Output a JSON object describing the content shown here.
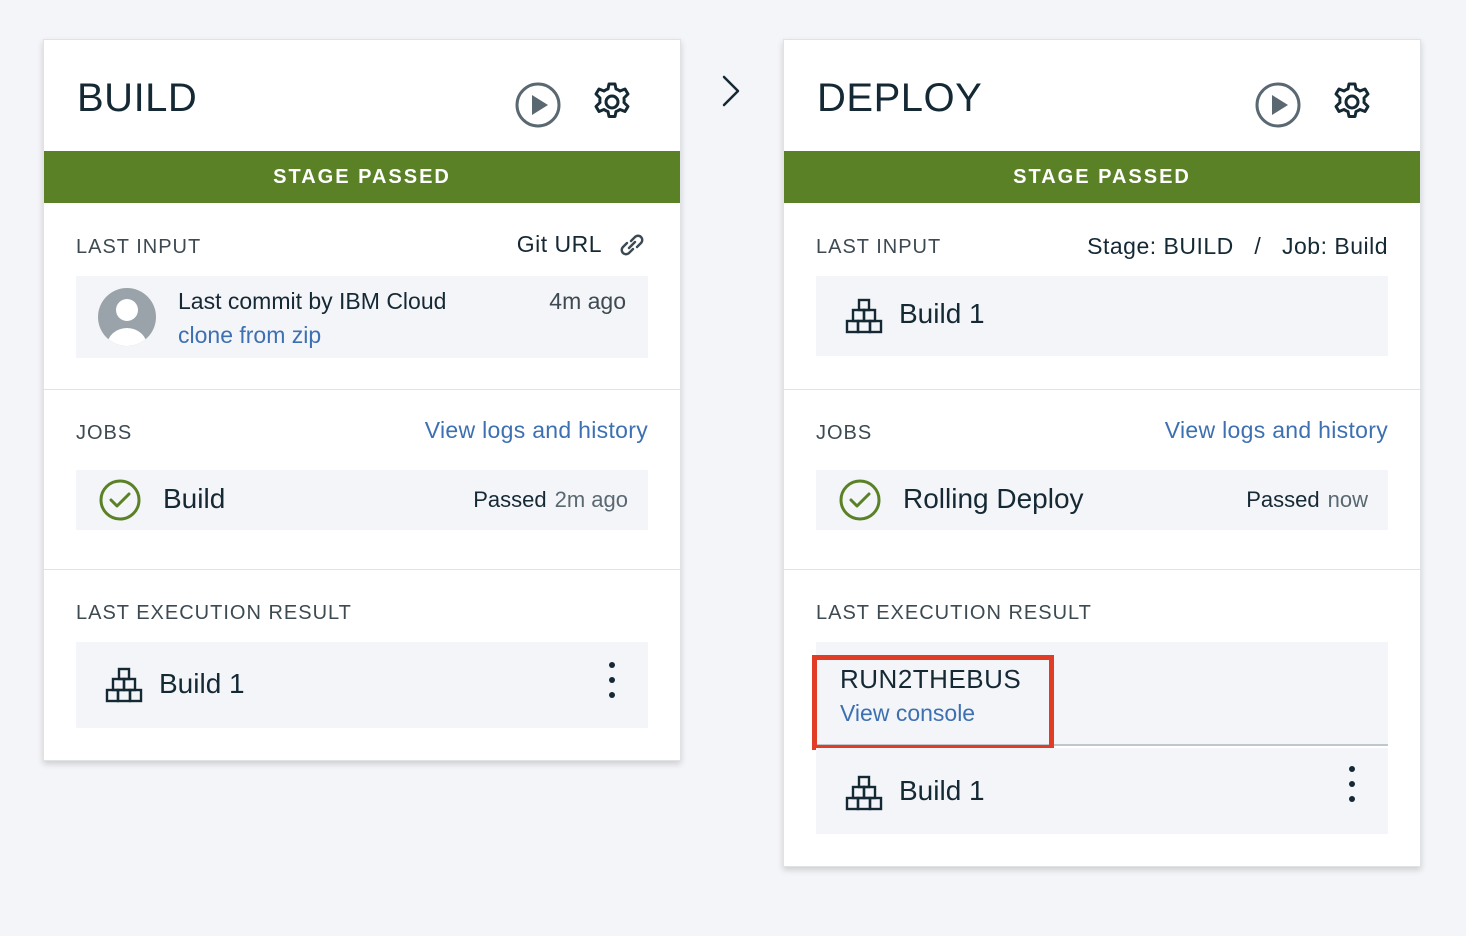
{
  "build_stage": {
    "title": "BUILD",
    "status": "STAGE PASSED",
    "last_input": {
      "label": "LAST INPUT",
      "source": "Git URL",
      "commit_title": "Last commit by IBM Cloud",
      "commit_link": "clone from zip",
      "commit_time": "4m ago"
    },
    "jobs": {
      "label": "JOBS",
      "link": "View logs and history",
      "items": [
        {
          "name": "Build",
          "status": "Passed",
          "time": "2m ago"
        }
      ]
    },
    "last_execution": {
      "label": "LAST EXECUTION RESULT",
      "build": "Build 1"
    }
  },
  "deploy_stage": {
    "title": "DEPLOY",
    "status": "STAGE PASSED",
    "last_input": {
      "label": "LAST INPUT",
      "source": "Stage: BUILD   /   Job: Build",
      "build": "Build 1"
    },
    "jobs": {
      "label": "JOBS",
      "link": "View logs and history",
      "items": [
        {
          "name": "Rolling Deploy",
          "status": "Passed",
          "time": "now"
        }
      ]
    },
    "last_execution": {
      "label": "LAST EXECUTION RESULT",
      "app_name": "RUN2THEBUS",
      "console_link": "View console",
      "build": "Build 1"
    }
  },
  "colors": {
    "status_passed": "#5a8126",
    "link": "#3d70b2",
    "highlight": "#e03c26",
    "success_icon": "#5a8126"
  },
  "icons": [
    "play-icon",
    "gear-icon",
    "link-icon",
    "avatar-icon",
    "checkmark-circle-icon",
    "build-blocks-icon",
    "kebab-menu-icon",
    "chevron-right-icon"
  ]
}
